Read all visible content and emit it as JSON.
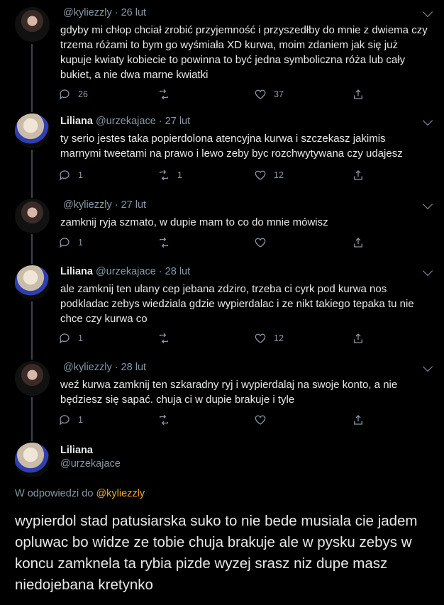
{
  "tweets": [
    {
      "display_name": "",
      "handle": "@kyliezzly",
      "date": "26 lut",
      "avatar": "dark",
      "text": "gdyby mi chłop chciał zrobić przyjemność i przyszedłby do mnie z dwiema czy trzema różami to bym go wyśmiała XD kurwa, moim zdaniem jak się już kupuje kwiaty kobiecie to powinna to być jedna symboliczna róża lub cały bukiet, a nie dwa marne kwiatki",
      "replies": "26",
      "retweets": "",
      "likes": "37"
    },
    {
      "display_name": "Liliana",
      "handle": "@urzekajace",
      "date": "27 lut",
      "avatar": "blonde",
      "text": "ty serio jestes taka popierdolona atencyjna kurwa i szczekasz jakimis marnymi tweetami na prawo i lewo zeby byc rozchwytywana czy udajesz",
      "replies": "1",
      "retweets": "1",
      "likes": "12"
    },
    {
      "display_name": "",
      "handle": "@kyliezzly",
      "date": "27 lut",
      "avatar": "dark",
      "text": "zamknij ryja szmato, w dupie mam to co do mnie mówisz",
      "replies": "1",
      "retweets": "",
      "likes": ""
    },
    {
      "display_name": "Liliana",
      "handle": "@urzekajace",
      "date": "28 lut",
      "avatar": "blonde",
      "text": "ale zamknij ten ulany cep jebana zdziro, trzeba ci cyrk pod kurwa nos podkladac zebys wiedziala gdzie wypierdalac i ze nikt takiego tepaka tu nie chce czy kurwa co",
      "replies": "1",
      "retweets": "",
      "likes": "12"
    },
    {
      "display_name": "",
      "handle": "@kyliezzly",
      "date": "28 lut",
      "avatar": "dark",
      "text": "weź kurwa zamknij ten szkaradny ryj i wypierdalaj na swoje konto, a nie będziesz się sapać. chuja ci w dupie brakuje i tyle",
      "replies": "1",
      "retweets": "",
      "likes": ""
    }
  ],
  "main_tweet": {
    "display_name": "Liliana",
    "handle": "@urzekajace",
    "reply_to_label": "W odpowiedzi do",
    "reply_to_handle": "@kyliezzly",
    "text": "wypierdol stad patusiarska suko to nie bede musiala cie jadem opluwac bo widze ze tobie chuja brakuje ale w pysku zebys w koncu zamknela ta rybia pizde wyzej srasz niz dupe masz niedojebana kretynko"
  },
  "icons": [
    "reply-icon",
    "retweet-icon",
    "like-icon",
    "share-icon",
    "chevron-down-icon"
  ],
  "colors": {
    "background": "#000000",
    "text": "#e7e9ea",
    "muted": "#8899a6",
    "mention": "#f5a623",
    "thread_line": "#38444d"
  }
}
